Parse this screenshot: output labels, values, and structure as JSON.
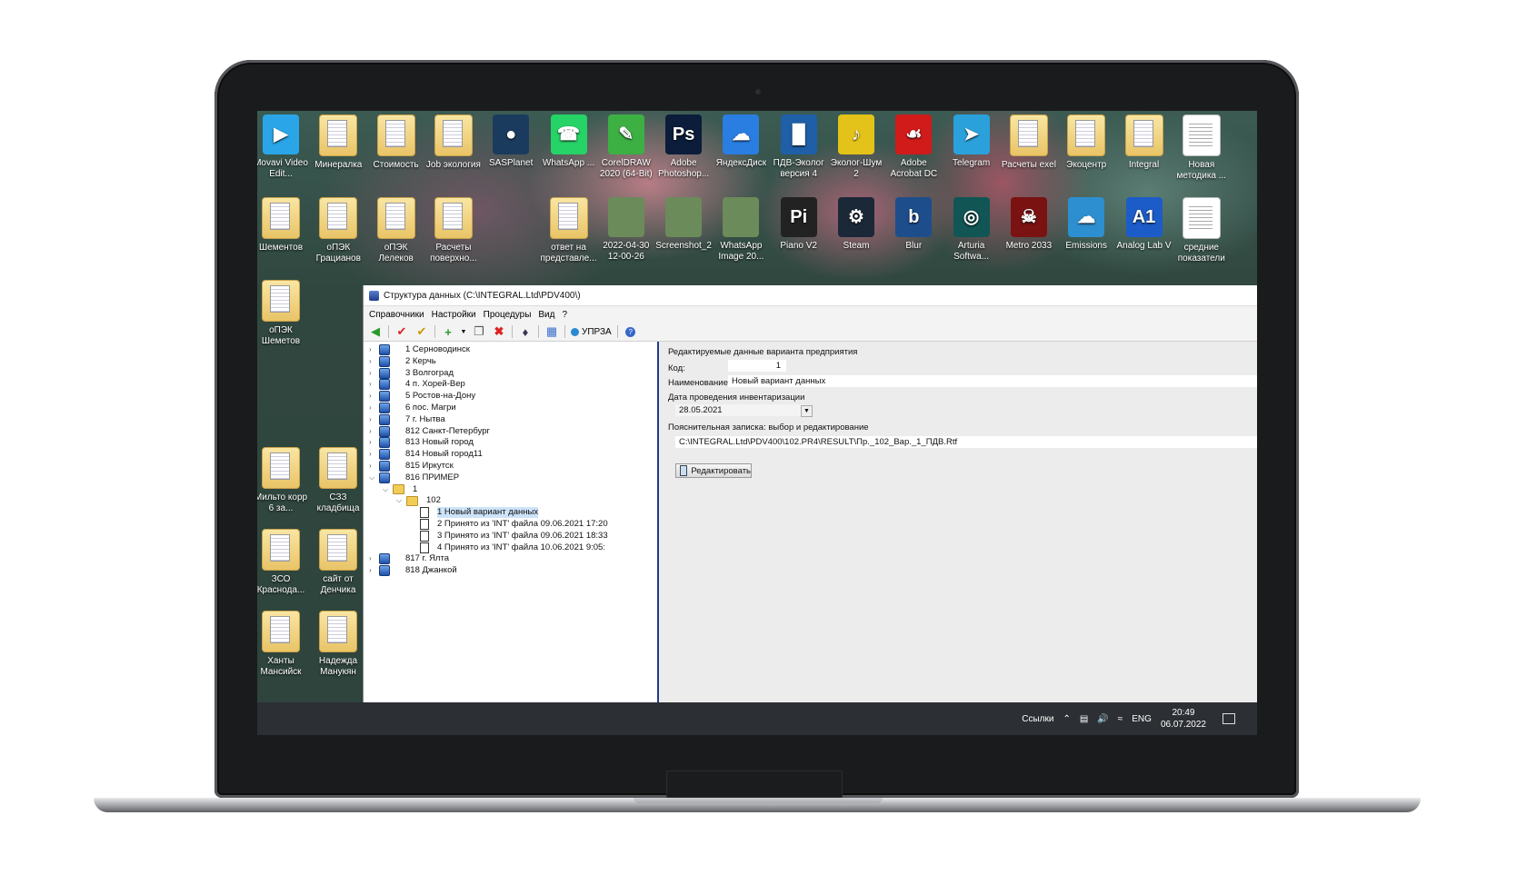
{
  "desktop": {
    "row1": [
      {
        "label": "Movavi Video Edit...",
        "icon": "video-camera-icon"
      },
      {
        "label": "Минералка",
        "icon": "folder-icon"
      },
      {
        "label": "Стоимость",
        "icon": "folder-icon"
      },
      {
        "label": "Job экология",
        "icon": "folder-icon"
      },
      {
        "label": "SASPlanet",
        "icon": "globe-icon"
      },
      {
        "label": "WhatsApp ...",
        "icon": "whatsapp-icon"
      },
      {
        "label": "CorelDRAW 2020 (64-Bit)",
        "icon": "coreldraw-icon"
      },
      {
        "label": "Adobe Photoshop...",
        "icon": "photoshop-icon"
      },
      {
        "label": "ЯндексДиск",
        "icon": "cloud-disk-icon"
      },
      {
        "label": "ПДВ-Эколог версия 4",
        "icon": "pdv-ecolog-icon"
      },
      {
        "label": "Эколог-Шум 2",
        "icon": "ecolog-noise-icon"
      },
      {
        "label": "Adobe Acrobat DC",
        "icon": "acrobat-icon"
      },
      {
        "label": "Telegram",
        "icon": "telegram-icon"
      },
      {
        "label": "Расчеты exel",
        "icon": "folder-icon"
      },
      {
        "label": "Экоцентр",
        "icon": "folder-icon"
      },
      {
        "label": "Integral",
        "icon": "folder-icon"
      },
      {
        "label": "Новая методика ...",
        "icon": "document-icon"
      }
    ],
    "row2": [
      {
        "label": "Шементов",
        "icon": "folder-icon"
      },
      {
        "label": "оПЭК Грацианов",
        "icon": "folder-icon"
      },
      {
        "label": "оПЭК Лелеков",
        "icon": "folder-icon"
      },
      {
        "label": "Расчеты поверхно...",
        "icon": "folder-icon"
      },
      {
        "label": "",
        "icon": "blank"
      },
      {
        "label": "ответ на представле...",
        "icon": "folder-icon"
      },
      {
        "label": "2022-04-30 12-00-26",
        "icon": "photo-icon"
      },
      {
        "label": "Screenshot_2",
        "icon": "photo-icon"
      },
      {
        "label": "WhatsApp Image 20...",
        "icon": "photo-icon"
      },
      {
        "label": "Piano V2",
        "icon": "piano-icon"
      },
      {
        "label": "Steam",
        "icon": "steam-icon"
      },
      {
        "label": "Blur",
        "icon": "blur-icon"
      },
      {
        "label": "Arturia Softwa...",
        "icon": "arturia-icon"
      },
      {
        "label": "Metro 2033",
        "icon": "game-icon"
      },
      {
        "label": "Emissions",
        "icon": "emissions-icon"
      },
      {
        "label": "Analog Lab V",
        "icon": "analog-lab-icon"
      },
      {
        "label": "средние показатели",
        "icon": "document-icon"
      }
    ],
    "col": [
      {
        "label": "оПЭК Шеметов",
        "icon": "folder-icon"
      },
      {
        "label": "Мильто корр 6 за...",
        "icon": "folder-icon"
      },
      {
        "label": "СЗЗ кладбища",
        "icon": "folder-icon"
      },
      {
        "label": "ЗСО Краснода...",
        "icon": "folder-icon"
      },
      {
        "label": "сайт от Денчика",
        "icon": "folder-icon"
      },
      {
        "label": "Ханты Мансийск",
        "icon": "folder-icon"
      },
      {
        "label": "Надежда Манукян",
        "icon": "folder-icon"
      }
    ]
  },
  "taskbar": {
    "links": "Ссылки",
    "lang": "ENG",
    "time": "20:49",
    "date": "06.07.2022"
  },
  "app": {
    "title": "Структура данных (C:\\INTEGRAL.Ltd\\PDV400\\)",
    "menu": [
      "Справочники",
      "Настройки",
      "Процедуры",
      "Вид",
      "?"
    ],
    "toolbar_upzra": "УПРЗА",
    "tree": [
      {
        "label": "1 Серноводинск",
        "level": 0,
        "exp": ">",
        "kind": "node"
      },
      {
        "label": "2 Керчь",
        "level": 0,
        "exp": ">",
        "kind": "node"
      },
      {
        "label": "3 Волгоград",
        "level": 0,
        "exp": ">",
        "kind": "node"
      },
      {
        "label": "4 п. Хорей-Вер",
        "level": 0,
        "exp": ">",
        "kind": "node"
      },
      {
        "label": "5 Ростов-на-Дону",
        "level": 0,
        "exp": ">",
        "kind": "node"
      },
      {
        "label": "6 пос. Магри",
        "level": 0,
        "exp": ">",
        "kind": "node"
      },
      {
        "label": "7 г. Нытва",
        "level": 0,
        "exp": ">",
        "kind": "node"
      },
      {
        "label": "812 Санкт-Петербург",
        "level": 0,
        "exp": ">",
        "kind": "node"
      },
      {
        "label": "813 Новый город",
        "level": 0,
        "exp": ">",
        "kind": "node"
      },
      {
        "label": "814 Новый город11",
        "level": 0,
        "exp": ">",
        "kind": "node"
      },
      {
        "label": "815 Иркутск",
        "level": 0,
        "exp": ">",
        "kind": "node"
      },
      {
        "label": "816 ПРИМЕР",
        "level": 0,
        "exp": "v",
        "kind": "node"
      },
      {
        "label": "1",
        "level": 1,
        "exp": "v",
        "kind": "folder"
      },
      {
        "label": "102",
        "level": 2,
        "exp": "v",
        "kind": "folder"
      },
      {
        "label": "1 Новый вариант данных",
        "level": 3,
        "exp": "",
        "kind": "doc",
        "selected": true
      },
      {
        "label": "2 Принято из 'INT' файла  09.06.2021 17:20",
        "level": 3,
        "exp": "",
        "kind": "doc"
      },
      {
        "label": "3 Принято из 'INT' файла  09.06.2021 18:33",
        "level": 3,
        "exp": "",
        "kind": "doc"
      },
      {
        "label": "4 Принято из 'INT' файла  10.06.2021 9:05:",
        "level": 3,
        "exp": "",
        "kind": "doc"
      },
      {
        "label": "817 г. Ялта",
        "level": 0,
        "exp": ">",
        "kind": "node"
      },
      {
        "label": "818 Джанкой",
        "level": 0,
        "exp": ">",
        "kind": "node"
      }
    ],
    "panel": {
      "section_title": "Редактируемые данные варианта предприятия",
      "code_label": "Код:",
      "code_value": "1",
      "name_label": "Наименование:",
      "name_value": "Новый вариант данных",
      "date_label": "Дата проведения инвентаризации",
      "date_value": "28.05.2021",
      "note_label": "Пояснительная записка: выбор и редактирование",
      "note_path": "C:\\INTEGRAL.Ltd\\PDV400\\102.PR4\\RESULT\\Пр._102_Вар._1_ПДВ.Rtf",
      "edit_button": "Редактировать"
    }
  },
  "colors": {
    "accent": "#1f3c8a",
    "selection": "#cde3f9"
  }
}
